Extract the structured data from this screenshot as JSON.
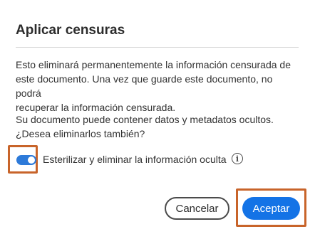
{
  "dialog": {
    "title": "Aplicar censuras",
    "paragraph1_line1": "Esto eliminará permanentemente la información censurada de",
    "paragraph1_line2": "este documento. Una vez que guarde este documento, no podrá",
    "paragraph1_line3": "recuperar la información censurada.",
    "paragraph2_line1": "Su documento puede contener datos y metadatos ocultos.",
    "paragraph2_line2": "¿Desea eliminarlos también?",
    "toggle": {
      "label": "Esterilizar y eliminar la información oculta",
      "checked": true,
      "icon": "toggle-switch"
    },
    "info_icon": {
      "glyph": "i",
      "icon": "info-icon"
    },
    "buttons": {
      "cancel_label": "Cancelar",
      "accept_label": "Aceptar"
    }
  },
  "colors": {
    "accent": "#1473e6",
    "toggle_on": "#2d7ad9",
    "highlight": "#c8642a"
  }
}
